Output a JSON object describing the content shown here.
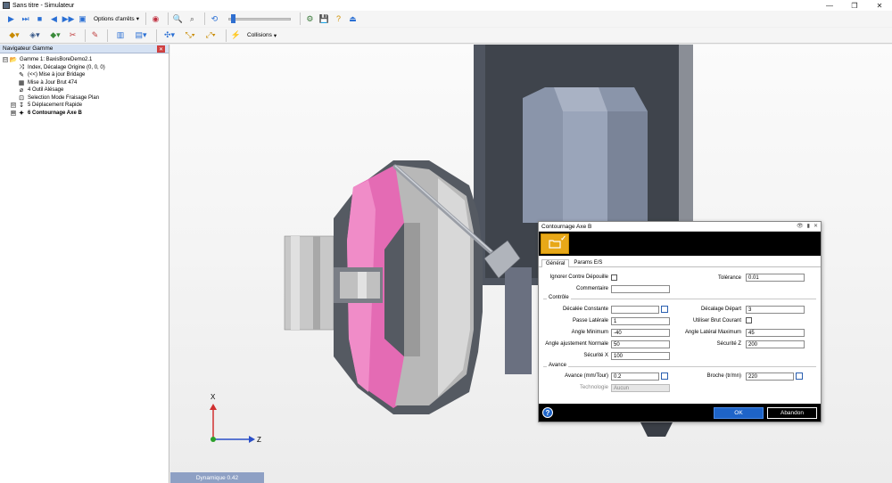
{
  "window": {
    "title": "Sans titre - Simulateur",
    "minimize": "—",
    "restore": "❐",
    "close": "✕"
  },
  "toolbar1": {
    "options_label": "Options d'arrêts",
    "dropdown_arrow": "▾",
    "slider_value": 0.05
  },
  "toolbar2": {
    "collisions_label": "Collisions"
  },
  "navigator": {
    "title": "Navigateur Gamme",
    "close": "✕",
    "items": [
      {
        "expander": "⊟",
        "icon": "📂",
        "label": "Gamme 1: BaxisBoreDemo2.1",
        "bold": false,
        "indent": 0
      },
      {
        "expander": "",
        "icon": "⤨",
        "label": "Index, Décalage Origine (0, 0, 0)",
        "bold": false,
        "indent": 1
      },
      {
        "expander": "",
        "icon": "✎",
        "label": "(<<) Mise à jour Bridage",
        "bold": false,
        "indent": 1
      },
      {
        "expander": "",
        "icon": "▦",
        "label": "Mise à Jour Brut 474",
        "bold": false,
        "indent": 1
      },
      {
        "expander": "",
        "icon": "⌀",
        "label": "4 Outil Alésage",
        "bold": false,
        "indent": 1
      },
      {
        "expander": "",
        "icon": "⊡",
        "label": "Selection Mode Fraisage Plan",
        "bold": false,
        "indent": 1
      },
      {
        "expander": "⊞",
        "icon": "↧",
        "label": "5 Déplacement Rapide",
        "bold": false,
        "indent": 1
      },
      {
        "expander": "⊞",
        "icon": "✦",
        "label": "6 Contournage Axe B",
        "bold": true,
        "indent": 1
      }
    ]
  },
  "viewport": {
    "status": "Dynamique 0.42",
    "axis_x": "X",
    "axis_z": "Z"
  },
  "dialog": {
    "title": "Contournage Axe B",
    "tabs": [
      "Général",
      "Params E/S"
    ],
    "active_tab": 0,
    "fields": {
      "ignorer_label": "Ignorer Contre Dépouille",
      "tolerance_label": "Tolérance",
      "tolerance_value": "0.01",
      "commentaire_label": "Commentaire",
      "commentaire_value": "",
      "controle_group": "Contrôle",
      "decalee_label": "Décalée Constante",
      "decalee_value": "",
      "decalage_depart_label": "Décalage Départ",
      "decalage_depart_value": "3",
      "passe_laterale_label": "Passe Latérale",
      "passe_laterale_value": "1",
      "utiliser_brut_label": "Utiliser Brut Courant",
      "angle_min_label": "Angle Minimum",
      "angle_min_value": "-40",
      "angle_lat_max_label": "Angle Latéral Maximum",
      "angle_lat_max_value": "45",
      "angle_ajust_label": "Angle ajustement Normale",
      "angle_ajust_value": "50",
      "securite_z_label": "Sécurité Z",
      "securite_z_value": "200",
      "securite_x_label": "Sécurité X",
      "securite_x_value": "100",
      "avance_group": "Avance",
      "avance_label": "Avance (mm/Tour)",
      "avance_value": "0.2",
      "broche_label": "Broche (tr/mn)",
      "broche_value": "220",
      "technologie_label": "Technologie",
      "technologie_value": "Aucun"
    },
    "ok_label": "OK",
    "cancel_label": "Abandon",
    "help": "?"
  },
  "colors": {
    "accent": "#1e64c8",
    "part_pink": "#e46bb4",
    "machine_dark": "#4f5560",
    "tool_blue": "#8a95aa"
  }
}
